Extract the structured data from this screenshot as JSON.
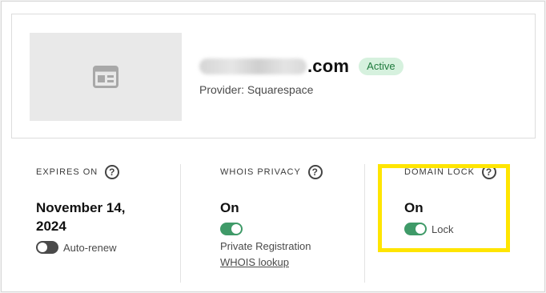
{
  "domain": {
    "name_suffix": ".com",
    "status_badge": "Active",
    "provider_text": "Provider: Squarespace",
    "thumbnail_icon": "website-placeholder-icon"
  },
  "columns": {
    "expires": {
      "title": "EXPIRES ON",
      "value_line1": "November 14,",
      "value_line2": "2024",
      "toggle_label": "Auto-renew",
      "toggle_on": false
    },
    "whois": {
      "title": "WHOIS PRIVACY",
      "value": "On",
      "toggle_label": "",
      "toggle_on": true,
      "sub_text": "Private Registration",
      "link_text": "WHOIS lookup"
    },
    "lock": {
      "title": "DOMAIN LOCK",
      "value": "On",
      "toggle_label": "Lock",
      "toggle_on": true
    }
  },
  "help_glyph": "?",
  "colors": {
    "badge_bg": "#d6f1de",
    "badge_text": "#1f7a3d",
    "toggle_on": "#3f9a68",
    "toggle_off": "#4a4a4a",
    "highlight": "#ffe500"
  }
}
